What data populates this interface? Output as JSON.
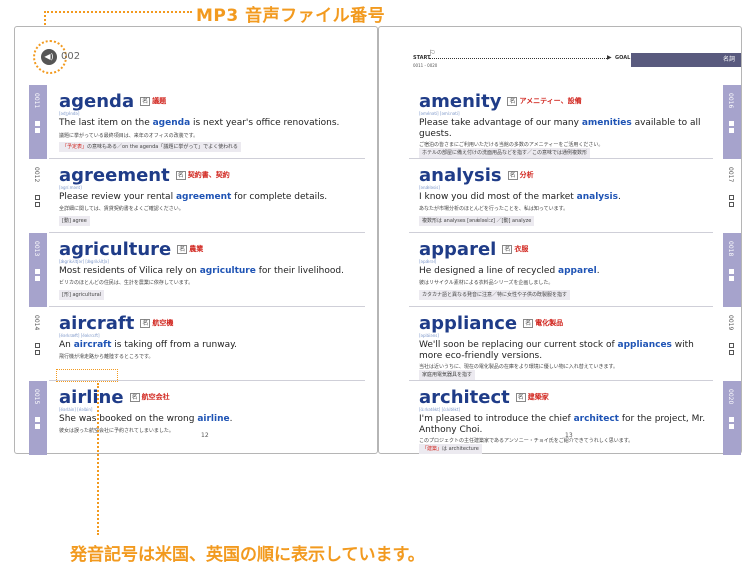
{
  "annotations": {
    "top_label": "MP3 音声ファイル番号",
    "bottom_label": "発音記号は米国、英国の順に表示しています。"
  },
  "header": {
    "track_number": "002",
    "audio_icon": "speaker-icon",
    "progress_start": "START",
    "progress_goal": "GOAL",
    "progress_range": "0011 - 0020",
    "part_of_speech_tab": "名詞"
  },
  "left_page": {
    "page_number": "12",
    "entries": [
      {
        "num": "0011",
        "word": "agenda",
        "pos": "名",
        "meaning": "議題",
        "pron": "[ədʒéndə]",
        "ex_before": "The last item on the ",
        "ex_word": "agenda",
        "ex_after": " is next year's office renovations.",
        "translation": "議題に挙がっている最終項目は、来年のオフィスの改装です。",
        "note_before": "「予定表」",
        "note_after": "の意味もある／on the agenda「議題に挙がって」でよく使われる"
      },
      {
        "num": "0012",
        "word": "agreement",
        "pos": "名",
        "meaning": "契約書、契約",
        "pron": "[əgríːmənt]",
        "ex_before": "Please review your rental ",
        "ex_word": "agreement",
        "ex_after": " for complete details.",
        "translation": "全詳細に関しては、賃貸契約書をよくご確認ください。",
        "note_before": "[動]",
        "note_after": " agree"
      },
      {
        "num": "0013",
        "word": "agriculture",
        "pos": "名",
        "meaning": "農業",
        "pron": "[ǽgrikʌ̀ltʃər] [ǽgrikʌ̀ltʃə]",
        "ex_before": "Most residents of Vilica rely on ",
        "ex_word": "agriculture",
        "ex_after": " for their livelihood.",
        "translation": "ビリカのほとんどの住民は、生計を農業に依存しています。",
        "note_before": "[形]",
        "note_after": " agricultural"
      },
      {
        "num": "0014",
        "word": "aircraft",
        "pos": "名",
        "meaning": "航空機",
        "pron": "[éərkræft] [éəkrɑːft]",
        "ex_before": "An ",
        "ex_word": "aircraft",
        "ex_after": " is taking off from a runway.",
        "translation": "飛行機が滑走路から離陸するところです。",
        "note_before": "",
        "note_after": ""
      },
      {
        "num": "0015",
        "word": "airline",
        "pos": "名",
        "meaning": "航空会社",
        "pron": "[éərlàin] [éəlàin]",
        "ex_before": "She was booked on the wrong ",
        "ex_word": "airline",
        "ex_after": ".",
        "translation": "彼女は誤った航空会社に予約されてしまいました。",
        "note_before": "",
        "note_after": ""
      }
    ]
  },
  "right_page": {
    "page_number": "13",
    "entries": [
      {
        "num": "0016",
        "word": "amenity",
        "pos": "名",
        "meaning": "アメニティー、設備",
        "pron": "[əménəti] [əmíːnəti]",
        "ex_before": "Please take advantage of our many ",
        "ex_word": "amenities",
        "ex_after": " available to all guests.",
        "translation": "ご宿泊の皆さまにご利用いただける当館の多数のアメニティーをご活用ください。",
        "note_before": "",
        "note_after": "ホテルの部屋に備え付けの洗面用品などを指す／この意味では通例複数形"
      },
      {
        "num": "0017",
        "word": "analysis",
        "pos": "名",
        "meaning": "分析",
        "pron": "[ənǽləsis]",
        "ex_before": "I know you did most of the market ",
        "ex_word": "analysis",
        "ex_after": ".",
        "translation": "あなたが市場分析のほとんどを行ったことを、私は知っています。",
        "note_before": "",
        "note_after": "複数形は analyses [ənǽləsìːz] ／[動] analyze"
      },
      {
        "num": "0018",
        "word": "apparel",
        "pos": "名",
        "meaning": "衣服",
        "pron": "[əpǽrəl]",
        "ex_before": "He designed a line of recycled ",
        "ex_word": "apparel",
        "ex_after": ".",
        "translation": "彼はリサイクル素材による衣料品シリーズを企画しました。",
        "note_before": "",
        "note_after": "カタカナ語と異なる発音に注意／特に女性や子供の既製服を指す"
      },
      {
        "num": "0019",
        "word": "appliance",
        "pos": "名",
        "meaning": "電化製品",
        "pron": "[əpláiəns]",
        "ex_before": "We'll soon be replacing our current stock of ",
        "ex_word": "appliances",
        "ex_after": " with more eco-friendly versions.",
        "translation": "当社は近いうちに、現在の電化製品の在庫をより環境に優しい物に入れ替えていきます。",
        "note_before": "",
        "note_after": "家庭用電気器具を指す"
      },
      {
        "num": "0020",
        "word": "architect",
        "pos": "名",
        "meaning": "建築家",
        "pron": "[ɑ́ːrkətèkt] [ɑ́ːkitèkt]",
        "ex_before": "I'm pleased to introduce the chief ",
        "ex_word": "architect",
        "ex_after": " for the project, Mr. Anthony Choi.",
        "translation": "このプロジェクトの主任建築家であるアンソニー・チョイ氏をご紹介できてうれしく思います。",
        "note_before": "「建築」",
        "note_after": "は architecture"
      }
    ]
  }
}
